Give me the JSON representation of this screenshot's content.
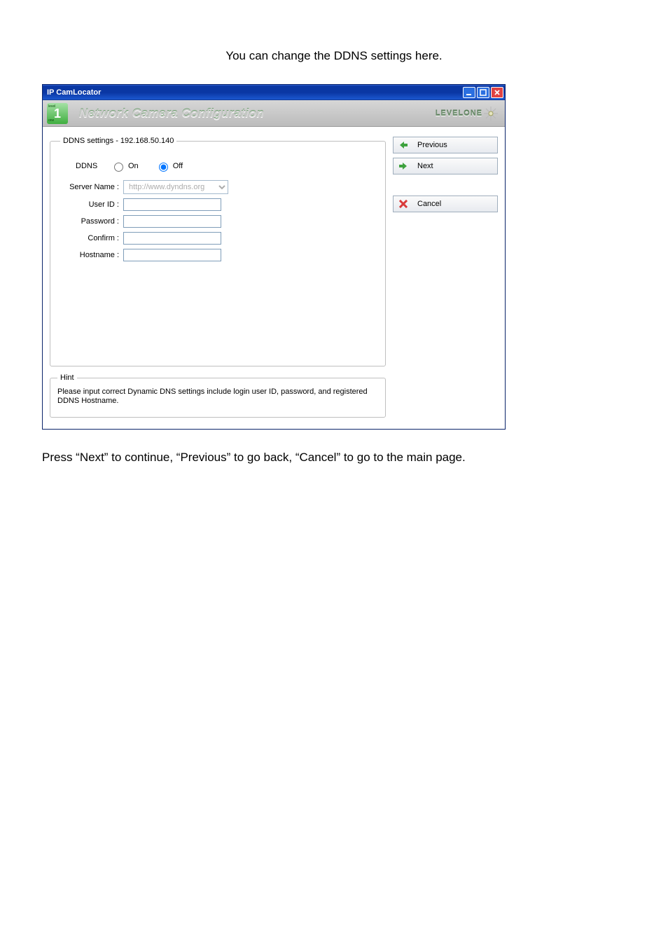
{
  "intro_text": "You can change the DDNS settings here.",
  "instruction_text": "Press “Next” to continue, “Previous” to go back, “Cancel” to go to the main page.",
  "window": {
    "title": "IP CamLocator"
  },
  "header": {
    "title": "Network Camera Configuration",
    "brand": "LEVELONE"
  },
  "groupbox": {
    "legend": "DDNS settings - 192.168.50.140",
    "ddns_label": "DDNS",
    "on_label": "On",
    "off_label": "Off",
    "ddns_value": "off",
    "server_label": "Server Name :",
    "server_selected": "http://www.dyndns.org",
    "userid_label": "User ID :",
    "userid_value": "",
    "password_label": "Password :",
    "password_value": "",
    "confirm_label": "Confirm :",
    "confirm_value": "",
    "hostname_label": "Hostname :",
    "hostname_value": ""
  },
  "sidebar": {
    "previous": "Previous",
    "next": "Next",
    "cancel": "Cancel"
  },
  "hint": {
    "legend": "Hint",
    "text": "Please input correct Dynamic DNS settings include login user ID, password, and registered DDNS Hostname."
  }
}
